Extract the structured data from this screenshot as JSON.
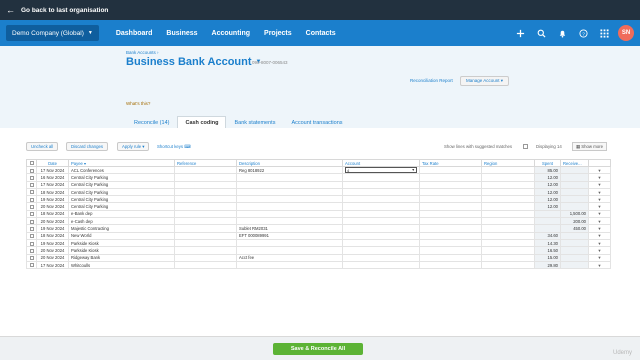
{
  "topbar": {
    "back_label": "Go back to last organisation"
  },
  "nav": {
    "org_name": "Demo Company (Global)",
    "items": [
      "Dashboard",
      "Business",
      "Accounting",
      "Projects",
      "Contacts"
    ],
    "avatar_initials": "SN"
  },
  "header": {
    "breadcrumb": "Bank Accounts ›",
    "title": "Business Bank Account",
    "account_number": "090-8007-006543",
    "reconciliation_report": "Reconciliation Report",
    "manage_account": "Manage Account ▾",
    "whats_this": "What's this?",
    "tabs": [
      "Reconcile (14)",
      "Cash coding",
      "Bank statements",
      "Account transactions"
    ]
  },
  "toolbar": {
    "uncheck_all": "Uncheck all",
    "discard_changes": "Discard changes",
    "apply_rule": "Apply rule ▾",
    "shortcut_keys": "Shortcut keys",
    "show_lines": "Show lines with suggested matches",
    "displaying": "Displaying 14",
    "show_more": "Show more"
  },
  "table": {
    "headers": [
      "Date",
      "Payee",
      "Reference",
      "Description",
      "Account",
      "Tax Rate",
      "Region",
      "Spent",
      "Receive..."
    ],
    "rows": [
      {
        "date": "17 Nov 2024",
        "payee": "ACL Conferences",
        "reference": "",
        "description": "Reg 8018922",
        "spent": "85.00",
        "received": ""
      },
      {
        "date": "16 Nov 2024",
        "payee": "Central City Parking",
        "reference": "",
        "description": "",
        "spent": "12.00",
        "received": ""
      },
      {
        "date": "17 Nov 2024",
        "payee": "Central City Parking",
        "reference": "",
        "description": "",
        "spent": "12.00",
        "received": ""
      },
      {
        "date": "18 Nov 2024",
        "payee": "Central City Parking",
        "reference": "",
        "description": "",
        "spent": "12.00",
        "received": ""
      },
      {
        "date": "19 Nov 2024",
        "payee": "Central City Parking",
        "reference": "",
        "description": "",
        "spent": "12.00",
        "received": ""
      },
      {
        "date": "20 Nov 2024",
        "payee": "Central City Parking",
        "reference": "",
        "description": "",
        "spent": "12.00",
        "received": ""
      },
      {
        "date": "18 Nov 2024",
        "payee": "e-Bank dep",
        "reference": "",
        "description": "",
        "spent": "",
        "received": "1,500.00"
      },
      {
        "date": "20 Nov 2024",
        "payee": "e-Cash dep",
        "reference": "",
        "description": "",
        "spent": "",
        "received": "200.00"
      },
      {
        "date": "19 Nov 2024",
        "payee": "Majestic Contracting",
        "reference": "",
        "description": "Sublet RM2031",
        "spent": "",
        "received": "450.00"
      },
      {
        "date": "18 Nov 2024",
        "payee": "New World",
        "reference": "",
        "description": "EFT 000089991",
        "spent": "34.60",
        "received": ""
      },
      {
        "date": "19 Nov 2024",
        "payee": "Parkside Kiosk",
        "reference": "",
        "description": "",
        "spent": "14.30",
        "received": ""
      },
      {
        "date": "20 Nov 2024",
        "payee": "Parkside Kiosk",
        "reference": "",
        "description": "",
        "spent": "16.50",
        "received": ""
      },
      {
        "date": "20 Nov 2024",
        "payee": "Ridgeway Bank",
        "reference": "",
        "description": "Acct fee",
        "spent": "15.00",
        "received": ""
      },
      {
        "date": "17 Nov 2024",
        "payee": "Whitcoulls",
        "reference": "",
        "description": "",
        "spent": "29.80",
        "received": ""
      }
    ],
    "active_account_value": "4"
  },
  "footer": {
    "save_reconcile": "Save & Reconcile All",
    "watermark": "Udemy"
  },
  "colors": {
    "nav_blue": "#1b7fcc",
    "topbar": "#22313f",
    "save_green": "#5cb335",
    "avatar": "#f06c5b"
  }
}
